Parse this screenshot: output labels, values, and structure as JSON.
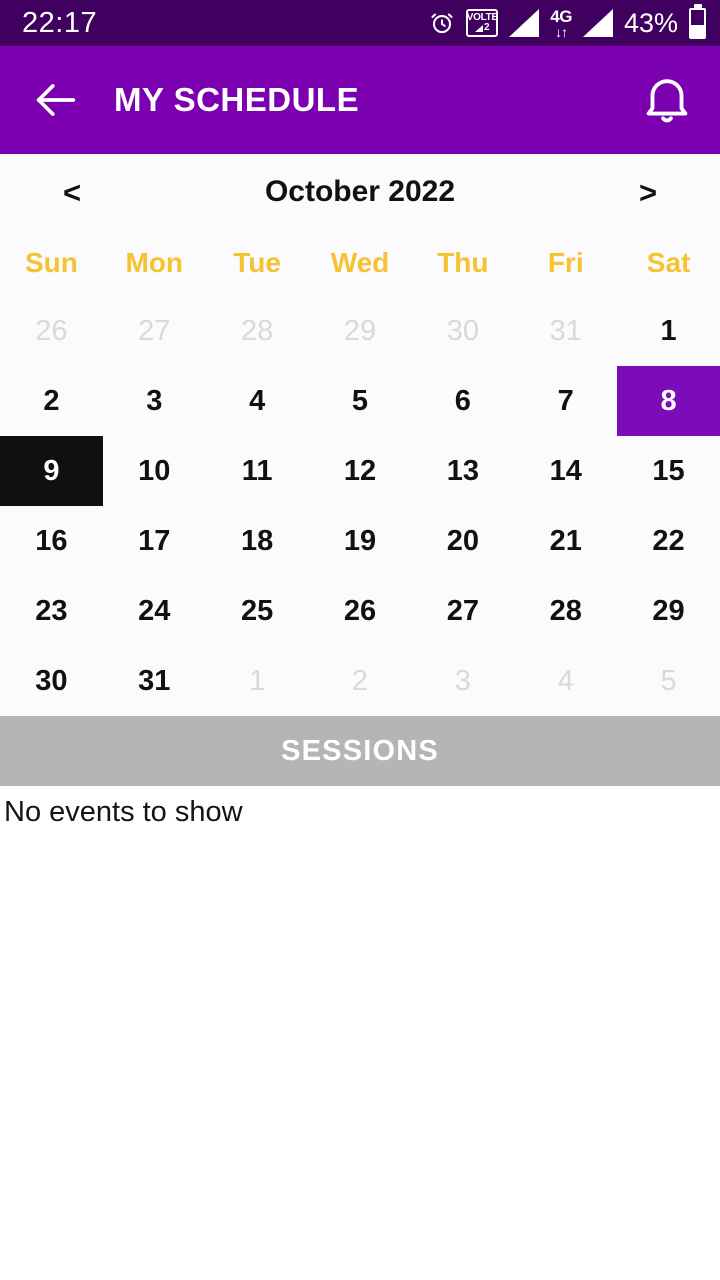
{
  "status_bar": {
    "time": "22:17",
    "battery_percent": "43%",
    "icons": [
      "alarm-clock-icon",
      "volte-icon",
      "signal-bars-icon",
      "4g-data-icon",
      "signal-bars-icon",
      "battery-icon"
    ],
    "volte_label": "VOLTE",
    "volte_sim": "2",
    "network_type": "4G",
    "background_color": "#40005f"
  },
  "app_bar": {
    "title": "MY SCHEDULE",
    "back_icon": "back-arrow-icon",
    "notification_icon": "bell-icon",
    "background_color": "#7a00b0"
  },
  "calendar": {
    "prev_label": "<",
    "next_label": ">",
    "month_label": "October 2022",
    "day_names": [
      "Sun",
      "Mon",
      "Tue",
      "Wed",
      "Thu",
      "Fri",
      "Sat"
    ],
    "day_name_color": "#f5c231",
    "selected_color": "#7b0cb8",
    "today_color": "#120f0f",
    "weeks": [
      [
        {
          "label": "26",
          "state": "muted"
        },
        {
          "label": "27",
          "state": "muted"
        },
        {
          "label": "28",
          "state": "muted"
        },
        {
          "label": "29",
          "state": "muted"
        },
        {
          "label": "30",
          "state": "muted"
        },
        {
          "label": "31",
          "state": "muted"
        },
        {
          "label": "1",
          "state": "normal"
        }
      ],
      [
        {
          "label": "2",
          "state": "normal"
        },
        {
          "label": "3",
          "state": "normal"
        },
        {
          "label": "4",
          "state": "normal"
        },
        {
          "label": "5",
          "state": "normal"
        },
        {
          "label": "6",
          "state": "normal"
        },
        {
          "label": "7",
          "state": "normal"
        },
        {
          "label": "8",
          "state": "selected"
        }
      ],
      [
        {
          "label": "9",
          "state": "today"
        },
        {
          "label": "10",
          "state": "normal"
        },
        {
          "label": "11",
          "state": "normal"
        },
        {
          "label": "12",
          "state": "normal"
        },
        {
          "label": "13",
          "state": "normal"
        },
        {
          "label": "14",
          "state": "normal"
        },
        {
          "label": "15",
          "state": "normal"
        }
      ],
      [
        {
          "label": "16",
          "state": "normal"
        },
        {
          "label": "17",
          "state": "normal"
        },
        {
          "label": "18",
          "state": "normal"
        },
        {
          "label": "19",
          "state": "normal"
        },
        {
          "label": "20",
          "state": "normal"
        },
        {
          "label": "21",
          "state": "normal"
        },
        {
          "label": "22",
          "state": "normal"
        }
      ],
      [
        {
          "label": "23",
          "state": "normal"
        },
        {
          "label": "24",
          "state": "normal"
        },
        {
          "label": "25",
          "state": "normal"
        },
        {
          "label": "26",
          "state": "normal"
        },
        {
          "label": "27",
          "state": "normal"
        },
        {
          "label": "28",
          "state": "normal"
        },
        {
          "label": "29",
          "state": "normal"
        }
      ],
      [
        {
          "label": "30",
          "state": "normal"
        },
        {
          "label": "31",
          "state": "normal"
        },
        {
          "label": "1",
          "state": "muted"
        },
        {
          "label": "2",
          "state": "muted"
        },
        {
          "label": "3",
          "state": "muted"
        },
        {
          "label": "4",
          "state": "muted"
        },
        {
          "label": "5",
          "state": "muted"
        }
      ]
    ]
  },
  "sessions": {
    "header": "SESSIONS",
    "header_background": "#b5b5b5",
    "empty_message": "No events to show"
  }
}
